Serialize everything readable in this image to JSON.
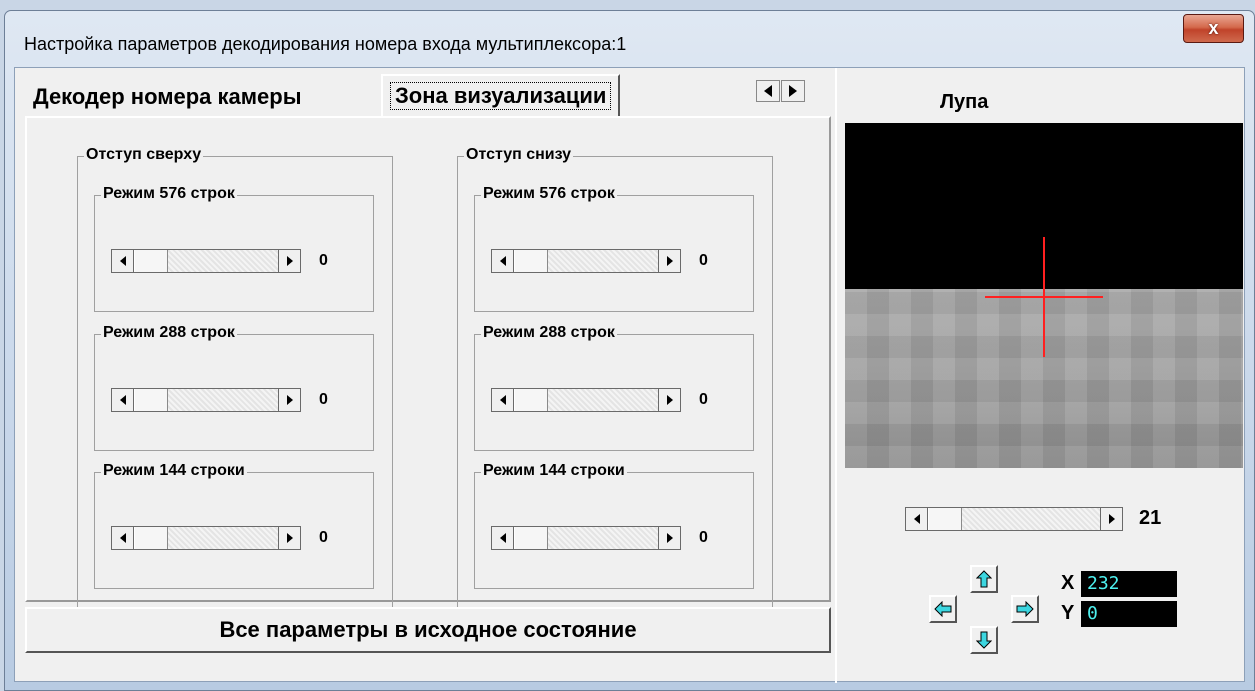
{
  "window": {
    "title": "Настройка параметров декодирования номера входа мультиплексора:1",
    "close_label": "x"
  },
  "tabs": [
    {
      "label": "Декодер номера камеры",
      "active": false
    },
    {
      "label": "Зона визуализации",
      "active": true
    }
  ],
  "tab_scroll": {
    "left_icon": "triangle-left-icon",
    "right_icon": "triangle-right-icon"
  },
  "top_group": {
    "title": "Отступ сверху",
    "modes": [
      {
        "label": "Режим 576 строк",
        "value": "0"
      },
      {
        "label": "Режим 288 строк",
        "value": "0"
      },
      {
        "label": "Режим 144 строки",
        "value": "0"
      }
    ]
  },
  "bottom_group": {
    "title": "Отступ снизу",
    "modes": [
      {
        "label": "Режим 576 строк",
        "value": "0"
      },
      {
        "label": "Режим 288 строк",
        "value": "0"
      },
      {
        "label": "Режим 144 строки",
        "value": "0"
      }
    ]
  },
  "reset_button": "Все параметры в исходное состояние",
  "magnifier": {
    "title": "Лупа",
    "zoom_value": "21",
    "x_label": "X",
    "x_value": "232",
    "y_label": "Y",
    "y_value": "0",
    "crosshair_color": "#ff2020"
  },
  "colors": {
    "coord_text": "#4ef0ef",
    "arrow_fill": "#3cd6e0"
  }
}
